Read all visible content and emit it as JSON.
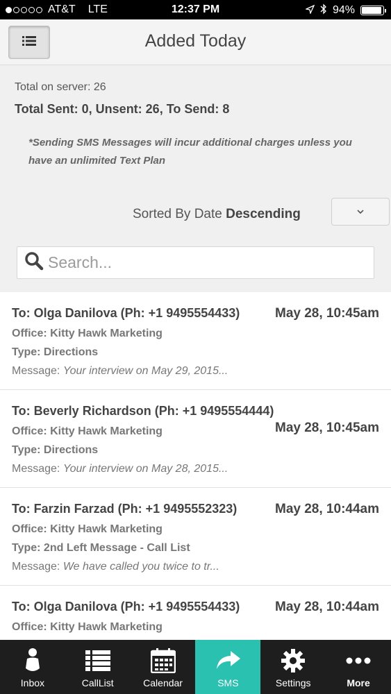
{
  "status_bar": {
    "carrier": "AT&T",
    "network": "LTE",
    "time": "12:37 PM",
    "battery": "94%",
    "battery_level": 0.94
  },
  "header": {
    "title": "Added Today",
    "menu_icon": "list-menu-icon"
  },
  "summary": {
    "total_on_server": "Total on server: 26",
    "totals": "Total Sent: 0, Unsent: 26, To Send: 8",
    "notice": "*Sending SMS Messages will incur additional charges unless you have an unlimited Text Plan"
  },
  "sort": {
    "prefix": "Sorted By Date",
    "order": "Descending"
  },
  "search": {
    "placeholder": "Search..."
  },
  "messages": [
    {
      "to": "To: Olga Danilova (Ph: +1 9495554433)",
      "date": "May 28, 10:45am",
      "office": "Office: Kitty Hawk Marketing",
      "type": "Type: Directions",
      "message_label": "Message:",
      "message": "Your interview on May 29, 2015..."
    },
    {
      "to": "To: Beverly Richardson (Ph: +1 9495554444)",
      "date": "May 28, 10:45am",
      "office": "Office: Kitty Hawk Marketing",
      "type": "Type: Directions",
      "message_label": "Message:",
      "message": "Your interview on May 28, 2015..."
    },
    {
      "to": "To: Farzin Farzad (Ph: +1 9495552323)",
      "date": "May 28, 10:44am",
      "office": "Office: Kitty Hawk Marketing",
      "type": "Type: 2nd Left Message - Call List",
      "message_label": "Message:",
      "message": "We have called you twice to tr..."
    },
    {
      "to": "To: Olga Danilova (Ph: +1 9495554433)",
      "date": "May 28, 10:44am",
      "office": "Office: Kitty Hawk Marketing"
    }
  ],
  "tabs": [
    {
      "label": "Inbox",
      "icon": "person-icon"
    },
    {
      "label": "CallList",
      "icon": "list-icon"
    },
    {
      "label": "Calendar",
      "icon": "calendar-icon"
    },
    {
      "label": "SMS",
      "icon": "share-arrow-icon"
    },
    {
      "label": "Settings",
      "icon": "gear-icon"
    },
    {
      "label": "More",
      "icon": "more-dots-icon"
    }
  ],
  "colors": {
    "active_tab": "#2ac1b0",
    "tab_bar": "#1e1e1e",
    "status_bar": "#000000"
  }
}
